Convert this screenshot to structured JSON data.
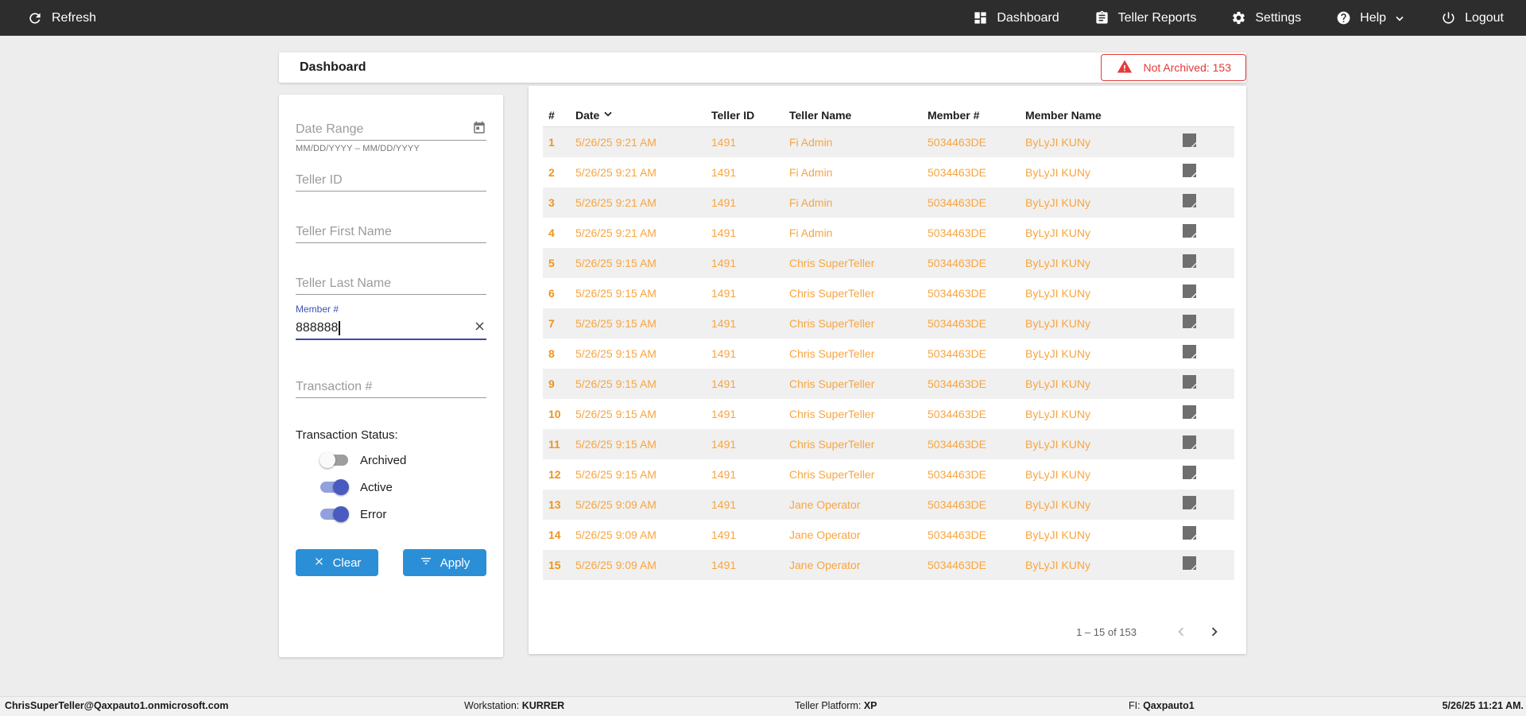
{
  "nav": {
    "refresh_label": "Refresh",
    "items": [
      {
        "label": "Dashboard",
        "icon": "dashboard-icon"
      },
      {
        "label": "Teller Reports",
        "icon": "clipboard-icon"
      },
      {
        "label": "Settings",
        "icon": "gear-icon"
      },
      {
        "label": "Help",
        "icon": "help-icon",
        "has_dropdown": true
      },
      {
        "label": "Logout",
        "icon": "power-icon"
      }
    ]
  },
  "header": {
    "title": "Dashboard",
    "alert_label": "Not Archived: 153"
  },
  "filters": {
    "date_range": {
      "placeholder": "Date Range",
      "hint": "MM/DD/YYYY – MM/DD/YYYY",
      "icon": "calendar-icon"
    },
    "teller_id_placeholder": "Teller ID",
    "teller_first_name_placeholder": "Teller First Name",
    "teller_last_name_placeholder": "Teller Last Name",
    "member_number": {
      "label": "Member #",
      "value": "888888",
      "focused": true
    },
    "transaction_number_placeholder": "Transaction #",
    "status_label": "Transaction Status:",
    "toggles": [
      {
        "label": "Archived",
        "on": false
      },
      {
        "label": "Active",
        "on": true
      },
      {
        "label": "Error",
        "on": true
      }
    ],
    "clear_label": "Clear",
    "apply_label": "Apply"
  },
  "table": {
    "columns": [
      "#",
      "Date",
      "Teller ID",
      "Teller Name",
      "Member #",
      "Member Name"
    ],
    "sort_column": "Date",
    "sort_direction": "desc",
    "rows": [
      {
        "num": "1",
        "date": "5/26/25 9:21 AM",
        "teller_id": "1491",
        "teller_name": "Fi Admin",
        "member_num": "5034463DE",
        "member_name": "ByLyJI KUNy"
      },
      {
        "num": "2",
        "date": "5/26/25 9:21 AM",
        "teller_id": "1491",
        "teller_name": "Fi Admin",
        "member_num": "5034463DE",
        "member_name": "ByLyJI KUNy"
      },
      {
        "num": "3",
        "date": "5/26/25 9:21 AM",
        "teller_id": "1491",
        "teller_name": "Fi Admin",
        "member_num": "5034463DE",
        "member_name": "ByLyJI KUNy"
      },
      {
        "num": "4",
        "date": "5/26/25 9:21 AM",
        "teller_id": "1491",
        "teller_name": "Fi Admin",
        "member_num": "5034463DE",
        "member_name": "ByLyJI KUNy"
      },
      {
        "num": "5",
        "date": "5/26/25 9:15 AM",
        "teller_id": "1491",
        "teller_name": "Chris SuperTeller",
        "member_num": "5034463DE",
        "member_name": "ByLyJI KUNy"
      },
      {
        "num": "6",
        "date": "5/26/25 9:15 AM",
        "teller_id": "1491",
        "teller_name": "Chris SuperTeller",
        "member_num": "5034463DE",
        "member_name": "ByLyJI KUNy"
      },
      {
        "num": "7",
        "date": "5/26/25 9:15 AM",
        "teller_id": "1491",
        "teller_name": "Chris SuperTeller",
        "member_num": "5034463DE",
        "member_name": "ByLyJI KUNy"
      },
      {
        "num": "8",
        "date": "5/26/25 9:15 AM",
        "teller_id": "1491",
        "teller_name": "Chris SuperTeller",
        "member_num": "5034463DE",
        "member_name": "ByLyJI KUNy"
      },
      {
        "num": "9",
        "date": "5/26/25 9:15 AM",
        "teller_id": "1491",
        "teller_name": "Chris SuperTeller",
        "member_num": "5034463DE",
        "member_name": "ByLyJI KUNy"
      },
      {
        "num": "10",
        "date": "5/26/25 9:15 AM",
        "teller_id": "1491",
        "teller_name": "Chris SuperTeller",
        "member_num": "5034463DE",
        "member_name": "ByLyJI KUNy"
      },
      {
        "num": "11",
        "date": "5/26/25 9:15 AM",
        "teller_id": "1491",
        "teller_name": "Chris SuperTeller",
        "member_num": "5034463DE",
        "member_name": "ByLyJI KUNy"
      },
      {
        "num": "12",
        "date": "5/26/25 9:15 AM",
        "teller_id": "1491",
        "teller_name": "Chris SuperTeller",
        "member_num": "5034463DE",
        "member_name": "ByLyJI KUNy"
      },
      {
        "num": "13",
        "date": "5/26/25 9:09 AM",
        "teller_id": "1491",
        "teller_name": "Jane Operator",
        "member_num": "5034463DE",
        "member_name": "ByLyJI KUNy"
      },
      {
        "num": "14",
        "date": "5/26/25 9:09 AM",
        "teller_id": "1491",
        "teller_name": "Jane Operator",
        "member_num": "5034463DE",
        "member_name": "ByLyJI KUNy"
      },
      {
        "num": "15",
        "date": "5/26/25 9:09 AM",
        "teller_id": "1491",
        "teller_name": "Jane Operator",
        "member_num": "5034463DE",
        "member_name": "ByLyJI KUNy"
      }
    ],
    "row_note_icon": "note-icon",
    "pagination_label": "1 – 15 of 153"
  },
  "footer": {
    "user": "ChrisSuperTeller@Qaxpauto1.onmicrosoft.com",
    "workstation_label": "Workstation: ",
    "workstation": "KURRER",
    "platform_label": "Teller Platform: ",
    "platform": "XP",
    "fi_label": "FI: ",
    "fi": "Qaxpauto1",
    "datetime": "5/26/25 11:21 AM."
  },
  "colors": {
    "nav_background": "#2d2d2d",
    "accent_blue": "#2b8fd8",
    "alert_red": "#e53935",
    "data_orange": "#f9a53f",
    "toggle_indigo": "#4a5bc0",
    "focused_field_blue": "#3949ab"
  }
}
